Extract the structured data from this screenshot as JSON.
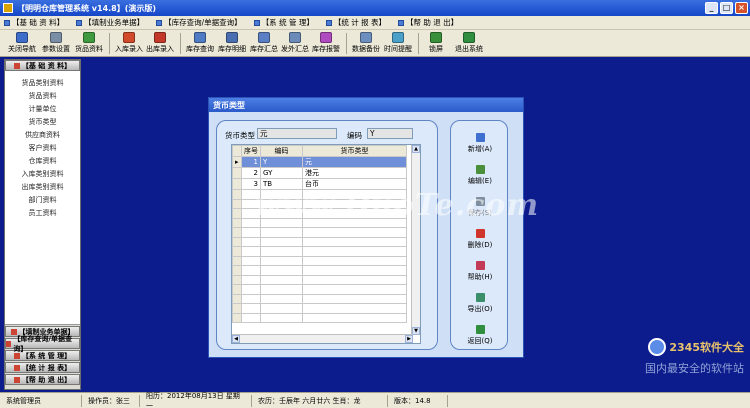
{
  "window": {
    "title": "【明明仓库管理系统 v14.8】(演示版)",
    "buttons": {
      "minimize": "_",
      "maximize": "□",
      "close": "×"
    }
  },
  "menu": [
    {
      "label": "【基 础 资 料】"
    },
    {
      "label": "【填制业务单据】"
    },
    {
      "label": "【库存查询/单据查询】"
    },
    {
      "label": "【系 统 管 理】"
    },
    {
      "label": "【统 计 报 表】"
    },
    {
      "label": "【帮 助 退 出】"
    }
  ],
  "toolbar": [
    {
      "label": "关闭导航",
      "icon": "close-nav-icon",
      "color": "#3d6cc9"
    },
    {
      "label": "参数设置",
      "icon": "settings-icon",
      "color": "#7a8fa6"
    },
    {
      "label": "货品资料",
      "icon": "goods-icon",
      "color": "#3f9a3f"
    },
    {
      "label": "入库录入",
      "icon": "stock-in-icon",
      "color": "#d04a2b"
    },
    {
      "label": "出库录入",
      "icon": "stock-out-icon",
      "color": "#c2392a"
    },
    {
      "label": "库存查询",
      "icon": "search-icon",
      "color": "#4f7ac4"
    },
    {
      "label": "库存明细",
      "icon": "detail-icon",
      "color": "#4a6fb0"
    },
    {
      "label": "库存汇总",
      "icon": "summary-icon",
      "color": "#5b7fc4"
    },
    {
      "label": "发外汇总",
      "icon": "outsource-icon",
      "color": "#6b8ab8"
    },
    {
      "label": "库存报警",
      "icon": "alarm-icon",
      "color": "#b04abf"
    },
    {
      "label": "数据备份",
      "icon": "backup-icon",
      "color": "#6d8fbf"
    },
    {
      "label": "时间提醒",
      "icon": "clock-icon",
      "color": "#4aa0c8"
    },
    {
      "label": "锁屏",
      "icon": "lock-icon",
      "color": "#3a8f3a"
    },
    {
      "label": "退出系统",
      "icon": "exit-icon",
      "color": "#2f8f3f"
    }
  ],
  "sidebar": {
    "header": "【基 础 资 料】",
    "items": [
      {
        "label": "货品类别资料"
      },
      {
        "label": "货品资料"
      },
      {
        "label": "计量单位"
      },
      {
        "label": "货币类型"
      },
      {
        "label": "供应商资料"
      },
      {
        "label": "客户资料"
      },
      {
        "label": "仓库资料"
      },
      {
        "label": "入库类别资料"
      },
      {
        "label": "出库类别资料"
      },
      {
        "label": "部门资料"
      },
      {
        "label": "员工资料"
      }
    ],
    "bottom_headers": [
      {
        "label": "【填制业务单据】"
      },
      {
        "label": "【库存查询/单据查询】"
      },
      {
        "label": "【系 统 管 理】"
      },
      {
        "label": "【统 计 报 表】"
      },
      {
        "label": "【帮 助 退 出】"
      }
    ]
  },
  "dialog": {
    "title": "货币类型",
    "fields": {
      "currency_type_label": "货币类型",
      "currency_type_value": "元",
      "code_label": "编码",
      "code_value": "Y"
    },
    "table": {
      "columns": [
        "序号",
        "编码",
        "货币类型"
      ],
      "rows": [
        {
          "no": "1",
          "code": "Y",
          "type": "元"
        },
        {
          "no": "2",
          "code": "GY",
          "type": "港元"
        },
        {
          "no": "3",
          "code": "TB",
          "type": "台币"
        }
      ]
    },
    "buttons": [
      {
        "label": "新增(A)",
        "icon": "add-icon",
        "color": "#3f6fcf"
      },
      {
        "label": "编辑(E)",
        "icon": "edit-icon",
        "color": "#4a8f3a"
      },
      {
        "label": "保存(S)",
        "icon": "save-icon",
        "color": "#7f8f9f"
      },
      {
        "label": "删除(D)",
        "icon": "delete-icon",
        "color": "#d0352b"
      },
      {
        "label": "帮助(H)",
        "icon": "help-icon",
        "color": "#c23a55"
      },
      {
        "label": "导出(O)",
        "icon": "export-icon",
        "color": "#3a8f6a"
      },
      {
        "label": "返回(Q)",
        "icon": "return-icon",
        "color": "#2f8f3f"
      }
    ]
  },
  "statusbar": {
    "cells": [
      "系统管理员",
      "操作员：张三",
      "阳历：2012年08月13日 星期一",
      "农历：壬辰年 六月廿六 生肖：龙",
      "版本：14.8"
    ]
  },
  "watermarks": {
    "main": "www.DuoTe.com",
    "brand": "2345软件大全",
    "slogan": "国内最安全的软件站"
  }
}
